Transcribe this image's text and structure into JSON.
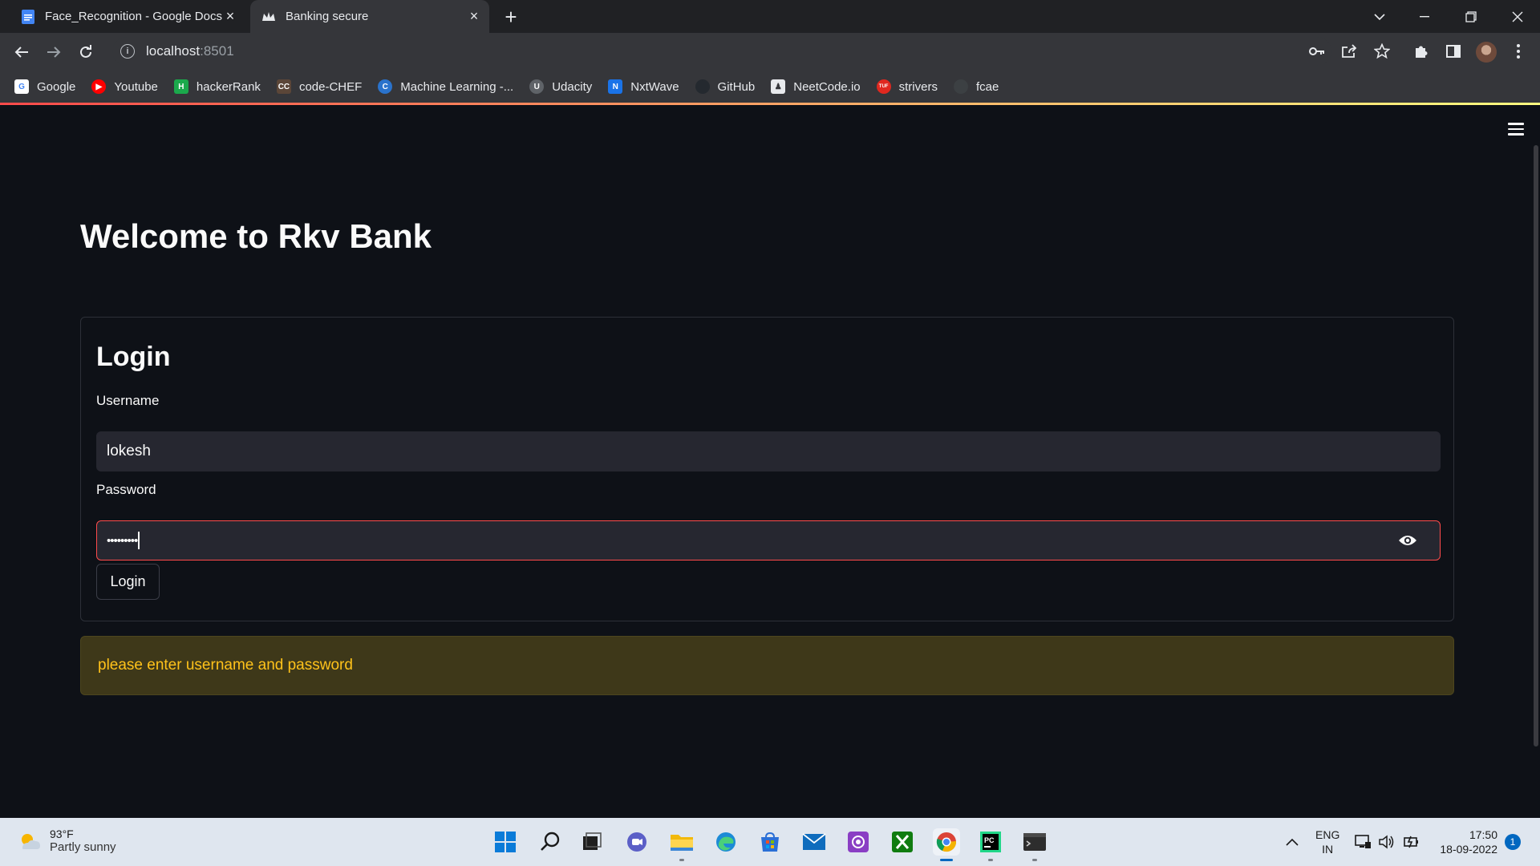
{
  "browser": {
    "tabs": [
      {
        "title": "Face_Recognition - Google Docs",
        "icon": "google-docs-icon"
      },
      {
        "title": "Banking secure",
        "icon": "streamlit-crown-icon"
      }
    ],
    "address": {
      "host": "localhost",
      "port": ":8501"
    },
    "bookmarks": [
      {
        "label": "Google",
        "icon": "google-icon",
        "color": "#ffffff"
      },
      {
        "label": "Youtube",
        "icon": "youtube-icon",
        "color": "#ff0000"
      },
      {
        "label": "hackerRank",
        "icon": "hackerrank-icon",
        "color": "#1ba94c"
      },
      {
        "label": "code-CHEF",
        "icon": "codechef-icon",
        "color": "#5b4638"
      },
      {
        "label": "Machine Learning -...",
        "icon": "coursera-icon",
        "color": "#2a73cc"
      },
      {
        "label": "Udacity",
        "icon": "udacity-icon",
        "color": "#5f6368"
      },
      {
        "label": "NxtWave",
        "icon": "nxtwave-icon",
        "color": "#1a73e8"
      },
      {
        "label": "GitHub",
        "icon": "github-icon",
        "color": "#24292f"
      },
      {
        "label": "NeetCode.io",
        "icon": "neetcode-icon",
        "color": "#e8eaed"
      },
      {
        "label": "strivers",
        "icon": "tuf-icon",
        "color": "#e0281f"
      },
      {
        "label": "fcae",
        "icon": "globe-icon",
        "color": "#3c4043"
      }
    ]
  },
  "app": {
    "heading": "Welcome to Rkv Bank",
    "login": {
      "title": "Login",
      "username_label": "Username",
      "username_value": "lokesh",
      "password_label": "Password",
      "password_mask": "•••••••••",
      "button_label": "Login"
    },
    "warning": "please enter username and password",
    "accent_color": "#ff4b4b",
    "warning_color": "#ffc21a"
  },
  "taskbar": {
    "weather": {
      "temp": "93°F",
      "condition": "Partly sunny"
    },
    "apps": [
      "windows-start-icon",
      "search-icon",
      "task-view-icon",
      "teams-chat-icon",
      "file-explorer-icon",
      "edge-icon",
      "microsoft-store-icon",
      "mail-icon",
      "photos-icon",
      "xbox-icon",
      "chrome-icon",
      "pycharm-icon",
      "terminal-icon"
    ],
    "language": {
      "line1": "ENG",
      "line2": "IN"
    },
    "time": "17:50",
    "date": "18-09-2022",
    "notifications": "1"
  }
}
